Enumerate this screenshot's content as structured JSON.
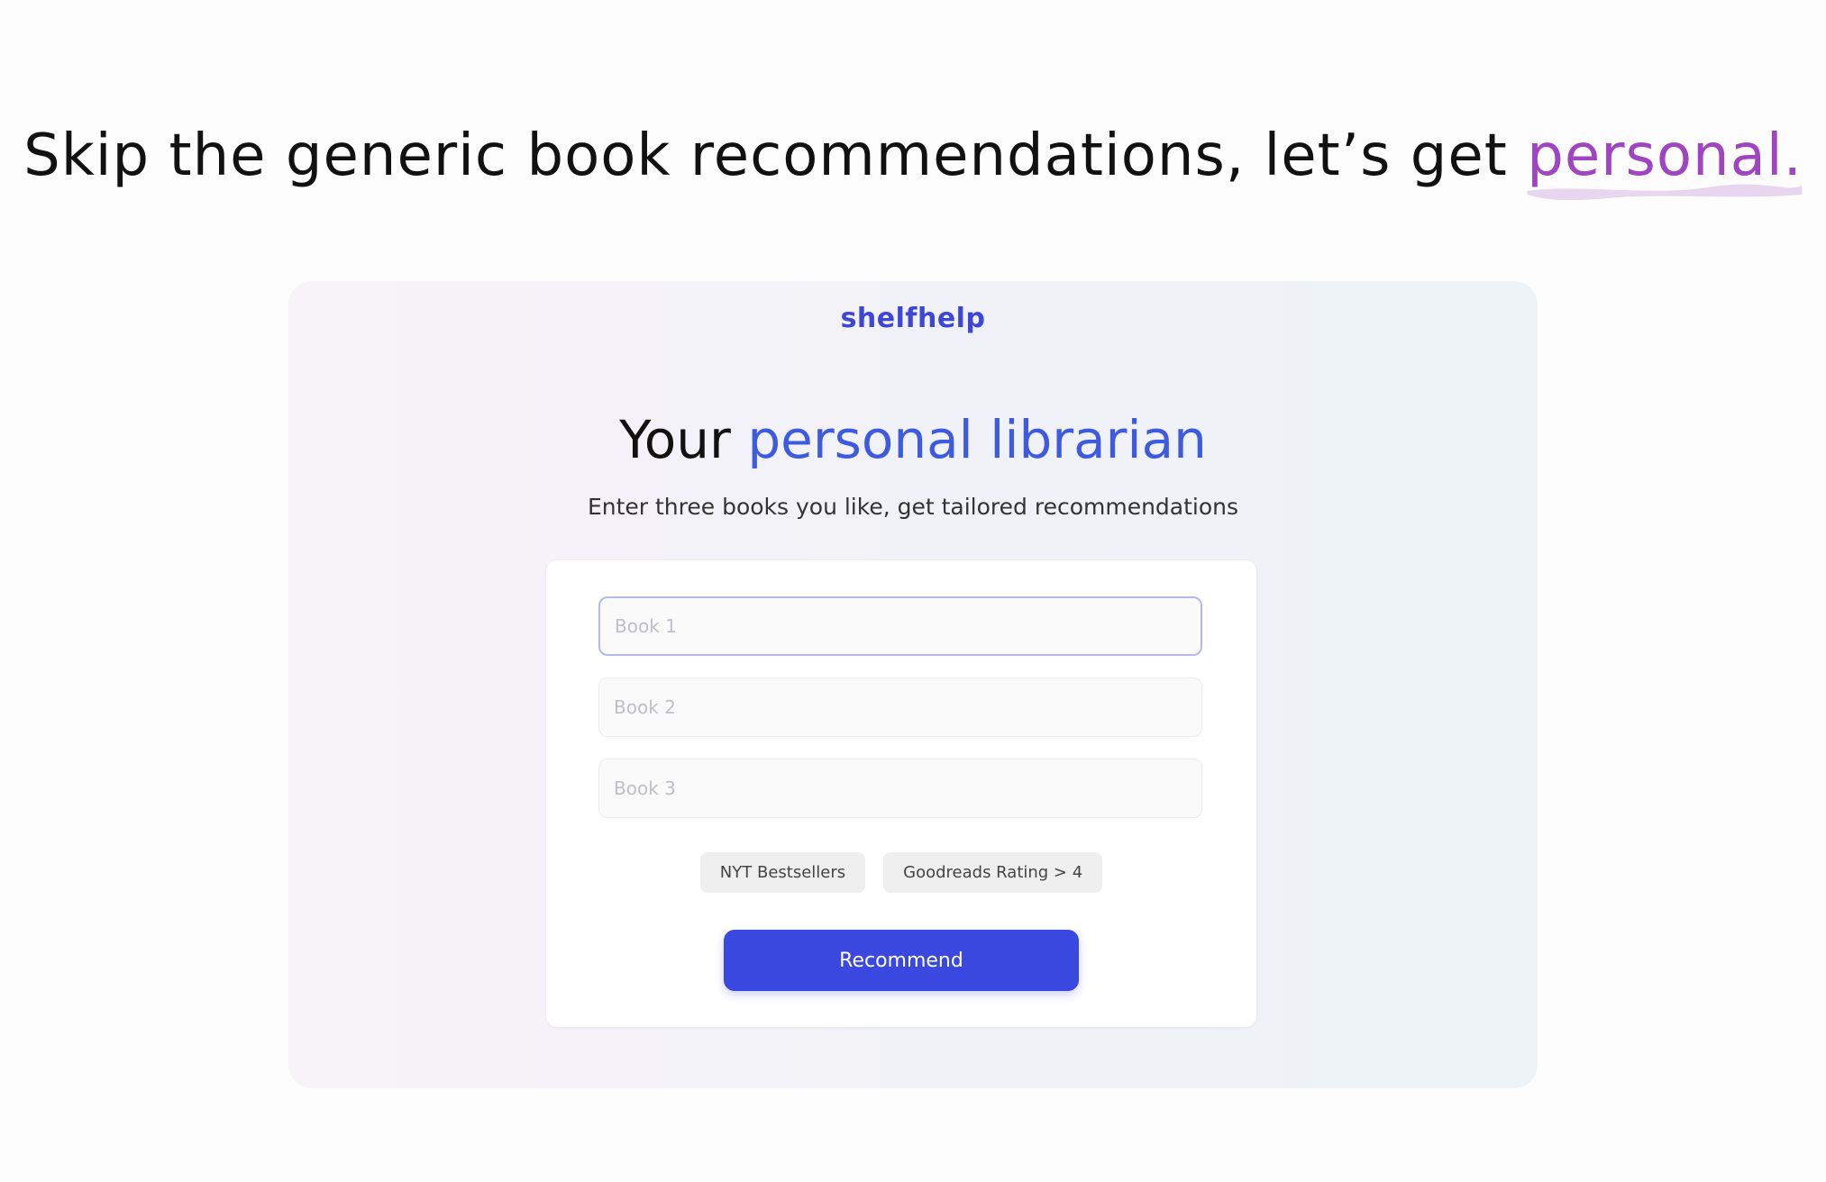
{
  "hero": {
    "title_prefix": "Skip the generic book recommendations, let’s get ",
    "title_accent": "personal.",
    "accent_color": "#a045c0"
  },
  "app": {
    "brand": "shelfhelp",
    "brand_color": "#3e46d6",
    "heading_prefix": "Your ",
    "heading_accent": "personal librarian",
    "heading_accent_color": "#3e5bdf",
    "subheading": "Enter three books you like, get tailored recommendations"
  },
  "form": {
    "book1": {
      "placeholder": "Book 1",
      "value": ""
    },
    "book2": {
      "placeholder": "Book 2",
      "value": ""
    },
    "book3": {
      "placeholder": "Book 3",
      "value": ""
    },
    "filters": [
      {
        "label": "NYT Bestsellers"
      },
      {
        "label": "Goodreads Rating > 4"
      }
    ],
    "submit_label": "Recommend",
    "submit_color": "#3a48e0"
  }
}
